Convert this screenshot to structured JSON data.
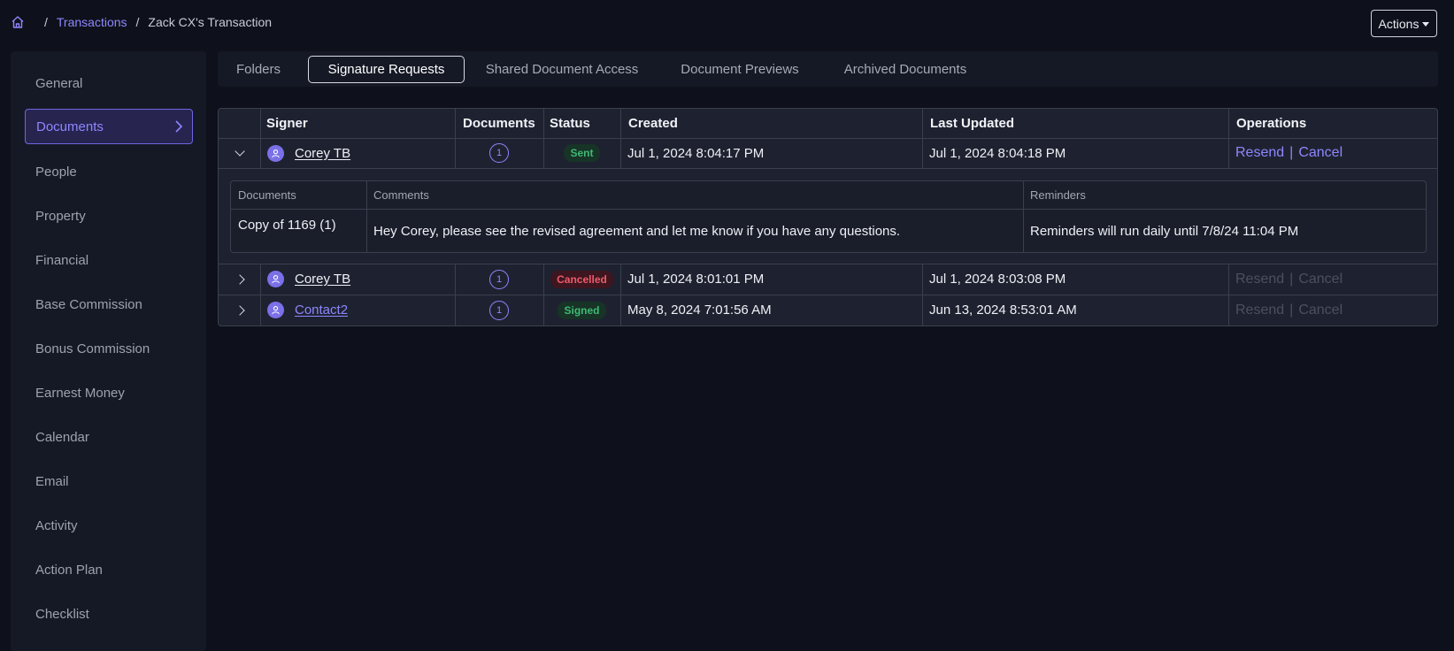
{
  "breadcrumb": {
    "home_icon": "home-icon",
    "separator": "/",
    "items": [
      "Transactions",
      "Zack CX's Transaction"
    ]
  },
  "actions": {
    "label": "Actions"
  },
  "sidebar": {
    "items": [
      {
        "label": "General"
      },
      {
        "label": "Documents",
        "active": true
      },
      {
        "label": "People"
      },
      {
        "label": "Property"
      },
      {
        "label": "Financial"
      },
      {
        "label": "Base Commission"
      },
      {
        "label": "Bonus Commission"
      },
      {
        "label": "Earnest Money"
      },
      {
        "label": "Calendar"
      },
      {
        "label": "Email"
      },
      {
        "label": "Activity"
      },
      {
        "label": "Action Plan"
      },
      {
        "label": "Checklist"
      }
    ]
  },
  "tabs": [
    {
      "label": "Folders"
    },
    {
      "label": "Signature Requests",
      "active": true
    },
    {
      "label": "Shared Document Access"
    },
    {
      "label": "Document Previews"
    },
    {
      "label": "Archived Documents"
    }
  ],
  "table": {
    "columns": [
      "",
      "Signer",
      "Documents",
      "Status",
      "Created",
      "Last Updated",
      "Operations"
    ],
    "rows": [
      {
        "expanded": true,
        "signer": "Corey TB",
        "documents": "1",
        "status": "Sent",
        "created": "Jul 1, 2024 8:04:17 PM",
        "updated": "Jul 1, 2024 8:04:18 PM",
        "resend": "Resend",
        "cancel": "Cancel",
        "ops_enabled": true
      },
      {
        "expanded": false,
        "signer": "Corey TB",
        "documents": "1",
        "status": "Cancelled",
        "created": "Jul 1, 2024 8:01:01 PM",
        "updated": "Jul 1, 2024 8:03:08 PM",
        "resend": "Resend",
        "cancel": "Cancel",
        "ops_enabled": false
      },
      {
        "expanded": false,
        "signer": "Contact2",
        "documents": "1",
        "status": "Signed",
        "created": "May 8, 2024 7:01:56 AM",
        "updated": "Jun 13, 2024 8:53:01 AM",
        "resend": "Resend",
        "cancel": "Cancel",
        "ops_enabled": false
      }
    ],
    "op_separator": "|",
    "detail": {
      "headers": [
        "Documents",
        "Comments",
        "Reminders"
      ],
      "document": "Copy of 1169 (1)",
      "comment": "Hey Corey, please see the revised agreement and let me know if you have any questions.",
      "reminder": "Reminders will run daily until 7/8/24 11:04 PM"
    }
  },
  "colors": {
    "background": "#0e111b",
    "panel": "#151925",
    "accent": "#8f86ff",
    "sent": "#3fb974",
    "cancelled": "#ef5a6a"
  }
}
